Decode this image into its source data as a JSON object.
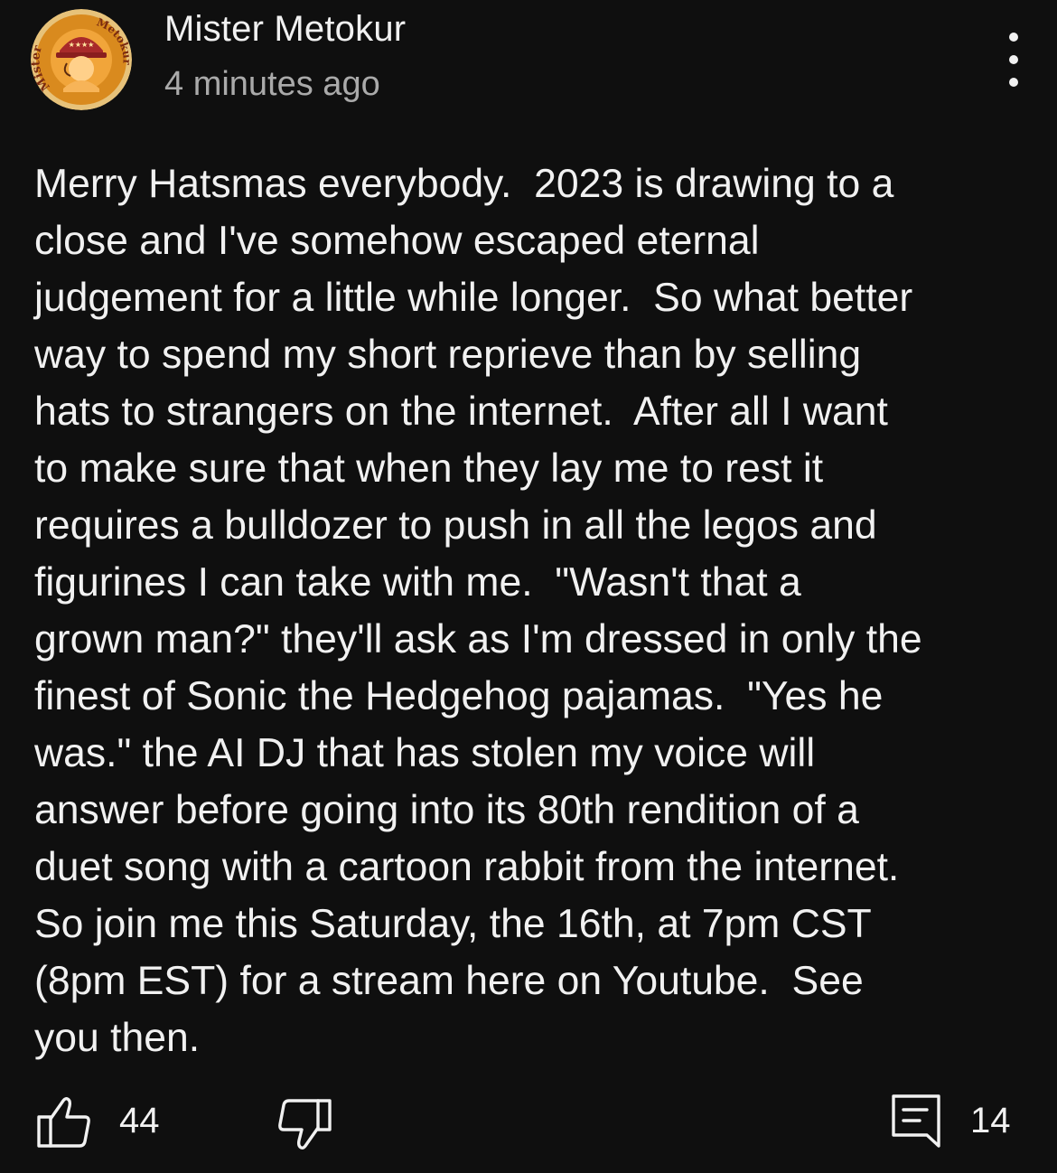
{
  "post": {
    "author": "Mister Metokur",
    "timestamp": "4 minutes ago",
    "avatar": {
      "ring_text_left": "Mister",
      "ring_text_right": "Metokur",
      "hat_stars": "★★★★",
      "ring_color": "#d98a1e",
      "face_color": "#f1a53a",
      "hat_color": "#a82a2a"
    },
    "body_lines": [
      "Merry Hatsmas everybody.  2023 is drawing to a",
      "close and I've somehow escaped eternal",
      "judgement for a little while longer.  So what better",
      "way to spend my short reprieve than by selling",
      "hats to strangers on the internet.  After all I want",
      "to make sure that when they lay me to rest it",
      "requires a bulldozer to push in all the legos and",
      "figurines I can take with me.  \"Wasn't that a",
      "grown man?\" they'll ask as I'm dressed in only the",
      "finest of Sonic the Hedgehog pajamas.  \"Yes he",
      "was.\" the AI DJ that has stolen my voice will",
      "answer before going into its 80th rendition of a",
      "duet song with a cartoon rabbit from the internet.",
      "So join me this Saturday, the 16th, at 7pm CST",
      "(8pm EST) for a stream here on Youtube.  See",
      "you then."
    ],
    "actions": {
      "like_icon": "thumbs-up-icon",
      "like_count": "44",
      "dislike_icon": "thumbs-down-icon",
      "comment_icon": "comment-icon",
      "comment_count": "14"
    }
  },
  "colors": {
    "background": "#0f0f0f",
    "primary_text": "#f1f1f1",
    "secondary_text": "#aaaaaa"
  }
}
